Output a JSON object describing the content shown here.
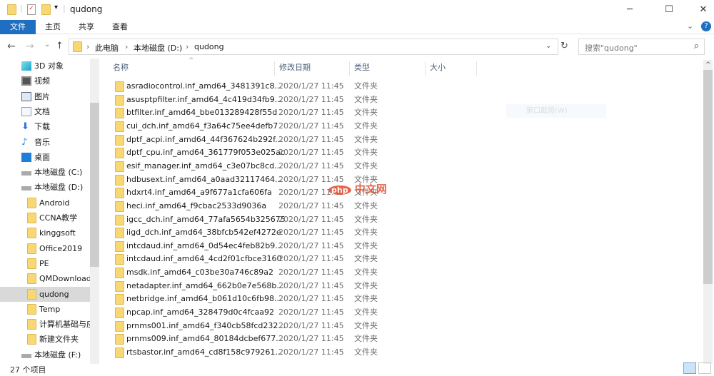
{
  "window": {
    "title": "qudong",
    "minimize": "─",
    "maximize": "☐",
    "close": "✕"
  },
  "ribbon": {
    "tabs": [
      "文件",
      "主页",
      "共享",
      "查看"
    ],
    "help": "?",
    "expand": "⌄"
  },
  "nav": {
    "back": "←",
    "forward": "→",
    "recent": "⌄",
    "up": "↑",
    "refresh": "↻",
    "dropdown": "⌄"
  },
  "address": {
    "crumbs": [
      "此电脑",
      "本地磁盘 (D:)",
      "qudong"
    ],
    "sep": "›"
  },
  "search": {
    "placeholder": "搜索\"qudong\"",
    "icon": "⌕"
  },
  "columns": {
    "name": "名称",
    "date": "修改日期",
    "type": "类型",
    "size": "大小"
  },
  "files": [
    {
      "name": "asradiocontrol.inf_amd64_3481391c8...",
      "date": "2020/1/27 11:45",
      "type": "文件夹"
    },
    {
      "name": "asusptpfilter.inf_amd64_4c419d34fb9...",
      "date": "2020/1/27 11:45",
      "type": "文件夹"
    },
    {
      "name": "btfilter.inf_amd64_bbe013289428f55d",
      "date": "2020/1/27 11:45",
      "type": "文件夹"
    },
    {
      "name": "cui_dch.inf_amd64_f3a64c75ee4defb7",
      "date": "2020/1/27 11:45",
      "type": "文件夹"
    },
    {
      "name": "dptf_acpi.inf_amd64_44f367624b292f...",
      "date": "2020/1/27 11:45",
      "type": "文件夹"
    },
    {
      "name": "dptf_cpu.inf_amd64_361779f053e025ac",
      "date": "2020/1/27 11:45",
      "type": "文件夹"
    },
    {
      "name": "esif_manager.inf_amd64_c3e07bc8cd...",
      "date": "2020/1/27 11:45",
      "type": "文件夹"
    },
    {
      "name": "hdbusext.inf_amd64_a0aad32117464...",
      "date": "2020/1/27 11:45",
      "type": "文件夹"
    },
    {
      "name": "hdxrt4.inf_amd64_a9f677a1cfa606fa",
      "date": "2020/1/27 11:45",
      "type": "文件夹"
    },
    {
      "name": "heci.inf_amd64_f9cbac2533d9036a",
      "date": "2020/1/27 11:45",
      "type": "文件夹"
    },
    {
      "name": "igcc_dch.inf_amd64_77afa5654b325675",
      "date": "2020/1/27 11:45",
      "type": "文件夹"
    },
    {
      "name": "iigd_dch.inf_amd64_38bfcb542ef4272e",
      "date": "2020/1/27 11:45",
      "type": "文件夹"
    },
    {
      "name": "intcdaud.inf_amd64_0d54ec4feb82b9...",
      "date": "2020/1/27 11:45",
      "type": "文件夹"
    },
    {
      "name": "intcdaud.inf_amd64_4cd2f01cfbce3160",
      "date": "2020/1/27 11:45",
      "type": "文件夹"
    },
    {
      "name": "msdk.inf_amd64_c03be30a746c89a2",
      "date": "2020/1/27 11:45",
      "type": "文件夹"
    },
    {
      "name": "netadapter.inf_amd64_662b0e7e568b...",
      "date": "2020/1/27 11:45",
      "type": "文件夹"
    },
    {
      "name": "netbridge.inf_amd64_b061d10c6fb98...",
      "date": "2020/1/27 11:45",
      "type": "文件夹"
    },
    {
      "name": "npcap.inf_amd64_328479d0c4fcaa92",
      "date": "2020/1/27 11:45",
      "type": "文件夹"
    },
    {
      "name": "prnms001.inf_amd64_f340cb58fcd232...",
      "date": "2020/1/27 11:45",
      "type": "文件夹"
    },
    {
      "name": "prnms009.inf_amd64_80184dcbef677...",
      "date": "2020/1/27 11:45",
      "type": "文件夹"
    },
    {
      "name": "rtsbastor.inf_amd64_cd8f158c979261...",
      "date": "2020/1/27 11:45",
      "type": "文件夹"
    }
  ],
  "sidebar": [
    {
      "label": "3D 对象",
      "icon": "cube-icon"
    },
    {
      "label": "视频",
      "icon": "video-icon"
    },
    {
      "label": "图片",
      "icon": "picture-icon"
    },
    {
      "label": "文档",
      "icon": "document-icon"
    },
    {
      "label": "下载",
      "icon": "download-icon"
    },
    {
      "label": "音乐",
      "icon": "music-icon"
    },
    {
      "label": "桌面",
      "icon": "desktop-icon"
    },
    {
      "label": "本地磁盘 (C:)",
      "icon": "drive-icon"
    },
    {
      "label": "本地磁盘 (D:)",
      "icon": "drive-icon"
    },
    {
      "label": "Android",
      "icon": "folder-icon"
    },
    {
      "label": "CCNA教学",
      "icon": "folder-icon"
    },
    {
      "label": "kinggsoft",
      "icon": "folder-icon"
    },
    {
      "label": "Office2019",
      "icon": "folder-icon"
    },
    {
      "label": "PE",
      "icon": "folder-icon"
    },
    {
      "label": "QMDownload",
      "icon": "folder-icon"
    },
    {
      "label": "qudong",
      "icon": "folder-icon"
    },
    {
      "label": "Temp",
      "icon": "folder-icon"
    },
    {
      "label": "计算机基础与应",
      "icon": "folder-icon"
    },
    {
      "label": "新建文件夹",
      "icon": "folder-icon"
    },
    {
      "label": "本地磁盘 (F:)",
      "icon": "drive-icon"
    }
  ],
  "status": {
    "count": "27 个项目"
  },
  "overlay": {
    "menu_item": "窗口截图(W)",
    "watermark": "php中文网"
  },
  "colors": {
    "accent": "#1e6fc1",
    "folder": "#f8d775"
  }
}
